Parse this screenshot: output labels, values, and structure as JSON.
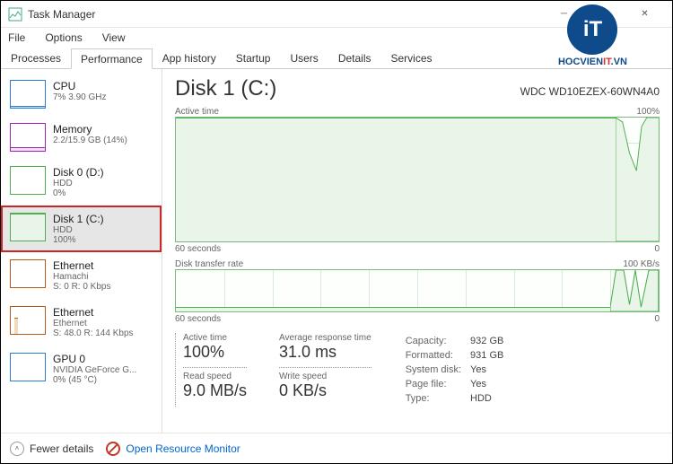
{
  "window": {
    "title": "Task Manager",
    "menus": [
      "File",
      "Options",
      "View"
    ]
  },
  "tabs": [
    "Processes",
    "Performance",
    "App history",
    "Startup",
    "Users",
    "Details",
    "Services"
  ],
  "active_tab": "Performance",
  "sidebar": [
    {
      "name": "CPU",
      "sub1": "7% 3.90 GHz",
      "sub2": "",
      "type": "cpu"
    },
    {
      "name": "Memory",
      "sub1": "2.2/15.9 GB (14%)",
      "sub2": "",
      "type": "mem"
    },
    {
      "name": "Disk 0 (D:)",
      "sub1": "HDD",
      "sub2": "0%",
      "type": "disk"
    },
    {
      "name": "Disk 1 (C:)",
      "sub1": "HDD",
      "sub2": "100%",
      "type": "disk",
      "selected": true
    },
    {
      "name": "Ethernet",
      "sub1": "Hamachi",
      "sub2": "S: 0 R: 0 Kbps",
      "type": "eth"
    },
    {
      "name": "Ethernet",
      "sub1": "Ethernet",
      "sub2": "S: 48.0 R: 144 Kbps",
      "type": "eth"
    },
    {
      "name": "GPU 0",
      "sub1": "NVIDIA GeForce G...",
      "sub2": "0% (45 °C)",
      "type": "gpu"
    }
  ],
  "main": {
    "title": "Disk 1 (C:)",
    "model": "WDC WD10EZEX-60WN4A0",
    "chart1": {
      "label": "Active time",
      "max": "100%",
      "xleft": "60 seconds",
      "xright": "0"
    },
    "chart2": {
      "label": "Disk transfer rate",
      "max": "100 KB/s",
      "xleft": "60 seconds",
      "xright": "0"
    },
    "stats": {
      "active_time": {
        "label": "Active time",
        "value": "100%"
      },
      "avg_resp": {
        "label": "Average response time",
        "value": "31.0 ms"
      },
      "read": {
        "label": "Read speed",
        "value": "9.0 MB/s"
      },
      "write": {
        "label": "Write speed",
        "value": "0 KB/s"
      }
    },
    "props": {
      "capacity": {
        "k": "Capacity:",
        "v": "932 GB"
      },
      "formatted": {
        "k": "Formatted:",
        "v": "931 GB"
      },
      "system_disk": {
        "k": "System disk:",
        "v": "Yes"
      },
      "page_file": {
        "k": "Page file:",
        "v": "Yes"
      },
      "type": {
        "k": "Type:",
        "v": "HDD"
      }
    }
  },
  "footer": {
    "fewer": "Fewer details",
    "resmon": "Open Resource Monitor"
  },
  "watermark": {
    "brand1": "HOCVIEN",
    "brand2": "IT",
    "brand3": ".VN",
    "it": "iT"
  },
  "chart_data": [
    {
      "type": "line",
      "title": "Active time",
      "xlabel": "seconds",
      "xrange": [
        60,
        0
      ],
      "ylabel": "%",
      "ylim": [
        0,
        100
      ],
      "series": [
        {
          "name": "Active time %",
          "x": [
            60,
            55,
            50,
            45,
            40,
            35,
            30,
            25,
            20,
            15,
            10,
            5,
            4,
            3,
            2,
            1,
            0
          ],
          "values": [
            100,
            100,
            100,
            100,
            100,
            100,
            100,
            100,
            100,
            100,
            100,
            98,
            80,
            65,
            95,
            100,
            100
          ]
        }
      ]
    },
    {
      "type": "line",
      "title": "Disk transfer rate",
      "xlabel": "seconds",
      "xrange": [
        60,
        0
      ],
      "ylabel": "KB/s",
      "ylim": [
        0,
        100
      ],
      "series": [
        {
          "name": "Transfer KB/s",
          "x": [
            60,
            55,
            50,
            45,
            40,
            35,
            30,
            25,
            20,
            15,
            10,
            5,
            4,
            3,
            2,
            1,
            0
          ],
          "values": [
            10,
            10,
            10,
            10,
            10,
            10,
            10,
            10,
            10,
            10,
            10,
            100,
            100,
            20,
            100,
            10,
            100
          ]
        }
      ]
    }
  ]
}
